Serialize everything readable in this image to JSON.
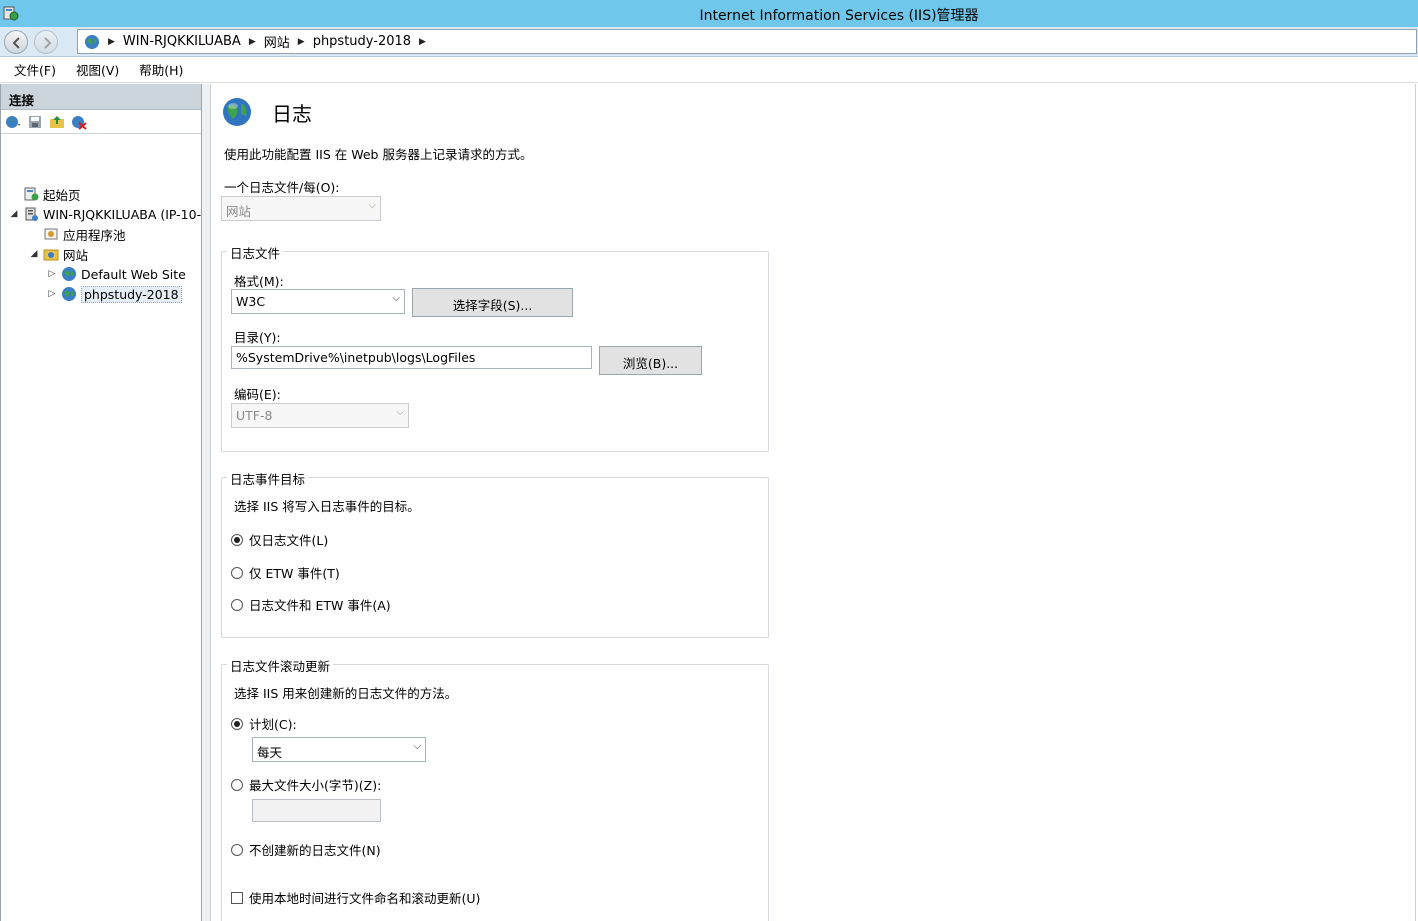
{
  "window": {
    "title": "Internet Information Services (IIS)管理器"
  },
  "breadcrumb": [
    "WIN-RJQKKILUABA",
    "网站",
    "phpstudy-2018"
  ],
  "menu": [
    "文件(F)",
    "视图(V)",
    "帮助(H)"
  ],
  "connections": {
    "header": "连接",
    "tree": [
      {
        "label": "起始页",
        "icon": "start-page-icon"
      },
      {
        "label": "WIN-RJQKKILUABA (IP-10-",
        "icon": "server-icon"
      },
      {
        "label": "应用程序池",
        "icon": "app-pools-icon"
      },
      {
        "label": "网站",
        "icon": "sites-folder-icon"
      },
      {
        "label": "Default Web Site",
        "icon": "globe-icon"
      },
      {
        "label": "phpstudy-2018",
        "icon": "globe-icon"
      }
    ]
  },
  "main": {
    "title": "日志",
    "description": "使用此功能配置 IIS 在 Web 服务器上记录请求的方式。",
    "one_log_file_per": {
      "label": "一个日志文件/每(O):",
      "value": "网站"
    },
    "log_file": {
      "group_title": "日志文件",
      "format_label": "格式(M):",
      "format_value": "W3C",
      "select_fields_button": "选择字段(S)...",
      "directory_label": "目录(Y):",
      "directory_value": "%SystemDrive%\\inetpub\\logs\\LogFiles",
      "browse_button": "浏览(B)...",
      "encoding_label": "编码(E):",
      "encoding_value": "UTF-8"
    },
    "log_event_destination": {
      "group_title": "日志事件目标",
      "description": "选择 IIS 将写入日志事件的目标。",
      "options": [
        "仅日志文件(L)",
        "仅 ETW 事件(T)",
        "日志文件和 ETW 事件(A)"
      ],
      "selected": 0
    },
    "rollover": {
      "group_title": "日志文件滚动更新",
      "description": "选择 IIS 用来创建新的日志文件的方法。",
      "schedule_label": "计划(C):",
      "schedule_value": "每天",
      "max_size_label": "最大文件大小(字节)(Z):",
      "max_size_value": "",
      "no_new_label": "不创建新的日志文件(N)",
      "local_time_label": "使用本地时间进行文件命名和滚动更新(U)",
      "selected": "schedule",
      "local_time_checked": false
    }
  },
  "colors": {
    "titlebar": "#6fc8ec",
    "navbar": "#dbe9f4",
    "pane_header": "#cdd5dc"
  }
}
